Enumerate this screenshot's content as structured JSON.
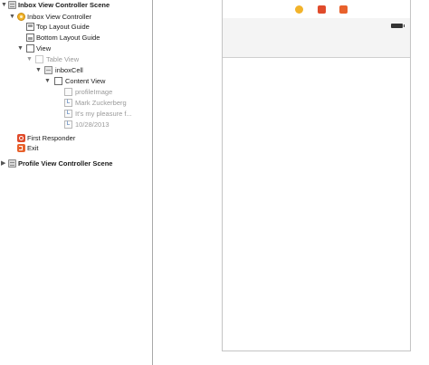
{
  "outline": {
    "inbox_scene": "Inbox View Controller Scene",
    "inbox_vc": "Inbox View Controller",
    "top_guide": "Top Layout Guide",
    "bottom_guide": "Bottom Layout Guide",
    "view": "View",
    "table_view": "Table View",
    "cell": "inboxCell",
    "content_view": "Content View",
    "profile_image": "profileImage",
    "name_label": "Mark Zuckerberg",
    "message_label": "It's my pleasure f...",
    "date_label": "10/28/2013",
    "first_responder": "First Responder",
    "exit": "Exit",
    "profile_scene": "Profile View Controller Scene",
    "label_icon_glyph": "L"
  },
  "canvas": {
    "dock_icons": [
      "view-controller-icon",
      "first-responder-icon",
      "exit-icon"
    ]
  }
}
